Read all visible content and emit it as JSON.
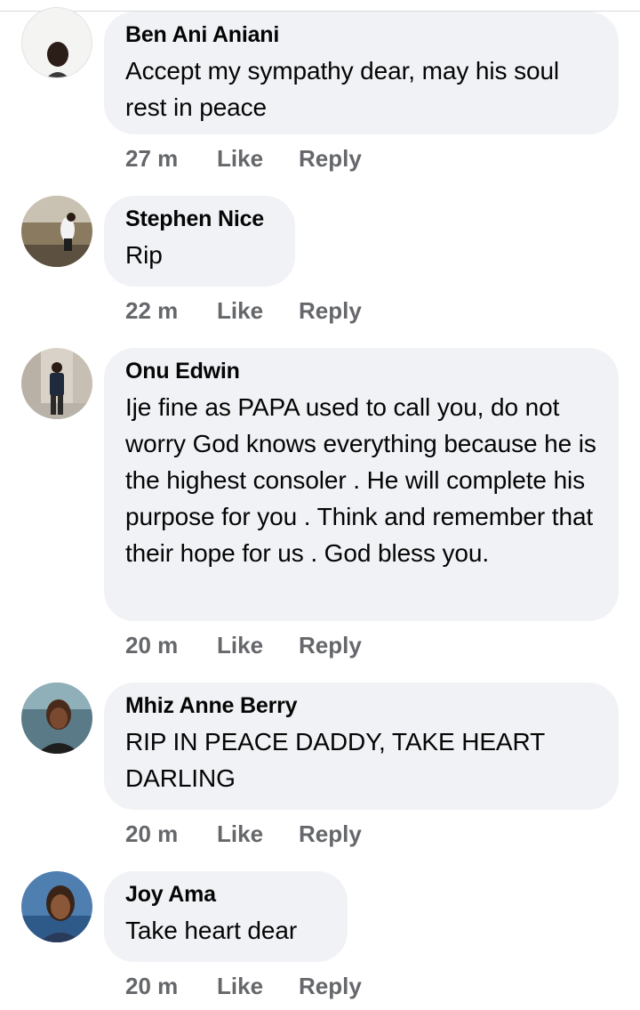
{
  "comments": [
    {
      "author": "Ben Ani Aniani",
      "text": "Accept my sympathy dear, may his soul rest in peace",
      "time": "27 m",
      "like_label": "Like",
      "reply_label": "Reply",
      "avatar_icon": "profile-photo-man-closeup"
    },
    {
      "author": "Stephen Nice",
      "text": "Rip",
      "time": "22 m",
      "like_label": "Like",
      "reply_label": "Reply",
      "avatar_icon": "profile-photo-man-outdoors"
    },
    {
      "author": "Onu Edwin",
      "text": "Ije fine as PAPA used to call you, do not worry God knows everything because he is the highest consoler . He will complete his purpose for you . Think and remember that their hope for us . God bless you.",
      "time": "20 m",
      "like_label": "Like",
      "reply_label": "Reply",
      "avatar_icon": "profile-photo-man-standing"
    },
    {
      "author": "Mhiz Anne Berry",
      "text": "RIP IN PEACE DADDY, TAKE HEART DARLING",
      "time": "20 m",
      "like_label": "Like",
      "reply_label": "Reply",
      "avatar_icon": "profile-photo-woman-smiling"
    },
    {
      "author": "Joy Ama",
      "text": "Take heart dear",
      "time": "20 m",
      "like_label": "Like",
      "reply_label": "Reply",
      "avatar_icon": "profile-photo-woman-portrait"
    }
  ],
  "colors": {
    "bubble_bg": "#f0f2f5",
    "text": "#050505",
    "meta": "#65676b"
  }
}
